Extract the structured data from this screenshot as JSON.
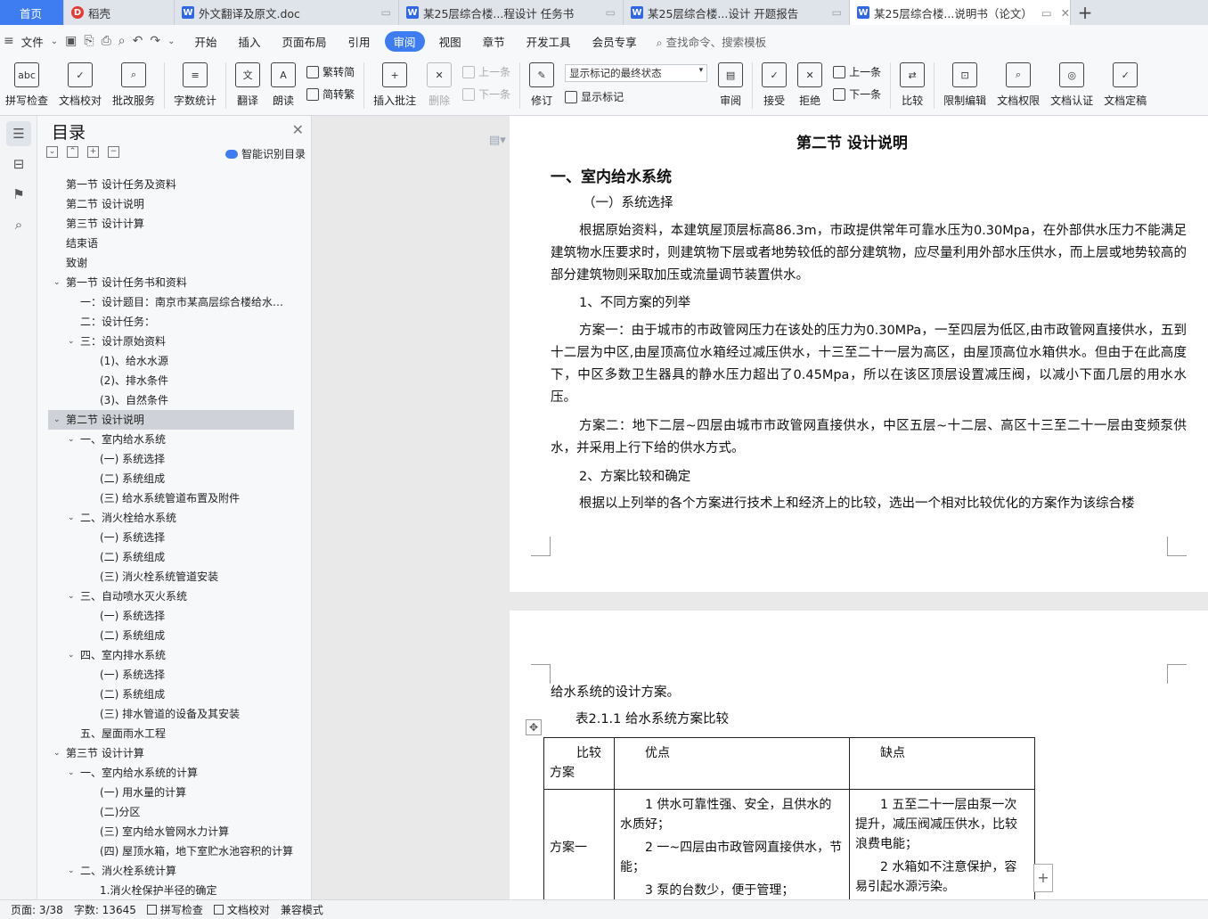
{
  "tabs": [
    {
      "label": "首页"
    },
    {
      "label": "稻壳"
    },
    {
      "label": "外文翻译及原文.doc"
    },
    {
      "label": "某25层综合楼...程设计 任务书"
    },
    {
      "label": "某25层综合楼...设计 开题报告"
    },
    {
      "label": "某25层综合楼...说明书（论文）"
    }
  ],
  "menu": {
    "file": "文件",
    "items": [
      "开始",
      "插入",
      "页面布局",
      "引用",
      "审阅",
      "视图",
      "章节",
      "开发工具",
      "会员专享"
    ],
    "active": "审阅",
    "search": "查找命令、搜索模板"
  },
  "ribbon": {
    "spell": "拼写检查",
    "proof": "文档校对",
    "batch": "批改服务",
    "wordcount": "字数统计",
    "translate": "翻译",
    "read": "朗读",
    "t2s": "繁转简",
    "s2t": "简转繁",
    "insert_comment": "插入批注",
    "delete": "删除",
    "prev": "上一条",
    "next": "下一条",
    "revise": "修订",
    "markup_state": "显示标记的最终状态",
    "show_markup": "显示标记",
    "review": "审阅",
    "accept": "接受",
    "reject": "拒绝",
    "prev2": "上一条",
    "next2": "下一条",
    "compare": "比较",
    "restrict": "限制编辑",
    "perm": "文档权限",
    "cert": "文档认证",
    "final": "文档定稿"
  },
  "toc": {
    "title": "目录",
    "smart": "智能识别目录",
    "items": [
      {
        "t": "第一节  设计任务及资料",
        "lvl": 1,
        "arrow": ""
      },
      {
        "t": "第二节  设计说明",
        "lvl": 1,
        "arrow": ""
      },
      {
        "t": "第三节  设计计算",
        "lvl": 1,
        "arrow": ""
      },
      {
        "t": "结束语",
        "lvl": 1,
        "arrow": ""
      },
      {
        "t": "致谢",
        "lvl": 1,
        "arrow": ""
      },
      {
        "t": "第一节  设计任务书和资料",
        "lvl": 1,
        "arrow": "v"
      },
      {
        "t": "一：设计题目：南京市某高层综合楼给水排水工程设计",
        "lvl": 2,
        "arrow": ""
      },
      {
        "t": "二：设计任务：",
        "lvl": 2,
        "arrow": ""
      },
      {
        "t": "三：设计原始资料",
        "lvl": 2,
        "arrow": "v"
      },
      {
        "t": "(1)、给水水源",
        "lvl": 3,
        "arrow": ""
      },
      {
        "t": "(2)、排水条件",
        "lvl": 3,
        "arrow": ""
      },
      {
        "t": "(3)、自然条件",
        "lvl": 3,
        "arrow": ""
      },
      {
        "t": "第二节  设计说明",
        "lvl": 1,
        "arrow": "v",
        "sel": true
      },
      {
        "t": "一、室内给水系统",
        "lvl": 2,
        "arrow": "v"
      },
      {
        "t": "(一) 系统选择",
        "lvl": 3,
        "arrow": ""
      },
      {
        "t": "(二) 系统组成",
        "lvl": 3,
        "arrow": ""
      },
      {
        "t": "(三)   给水系统管道布置及附件",
        "lvl": 3,
        "arrow": ""
      },
      {
        "t": "二、消火栓给水系统",
        "lvl": 2,
        "arrow": "v"
      },
      {
        "t": "(一) 系统选择",
        "lvl": 3,
        "arrow": ""
      },
      {
        "t": "(二) 系统组成",
        "lvl": 3,
        "arrow": ""
      },
      {
        "t": "(三) 消火栓系统管道安装",
        "lvl": 3,
        "arrow": ""
      },
      {
        "t": "三、自动喷水灭火系统",
        "lvl": 2,
        "arrow": "v"
      },
      {
        "t": "(一) 系统选择",
        "lvl": 3,
        "arrow": ""
      },
      {
        "t": "(二) 系统组成",
        "lvl": 3,
        "arrow": ""
      },
      {
        "t": "四、室内排水系统",
        "lvl": 2,
        "arrow": "v"
      },
      {
        "t": "(一) 系统选择",
        "lvl": 3,
        "arrow": ""
      },
      {
        "t": "(二) 系统组成",
        "lvl": 3,
        "arrow": ""
      },
      {
        "t": "(三) 排水管道的设备及其安装",
        "lvl": 3,
        "arrow": ""
      },
      {
        "t": "五、屋面雨水工程",
        "lvl": 2,
        "arrow": ""
      },
      {
        "t": "第三节 设计计算",
        "lvl": 1,
        "arrow": "v"
      },
      {
        "t": "一、室内给水系统的计算",
        "lvl": 2,
        "arrow": "v"
      },
      {
        "t": "(一) 用水量的计算",
        "lvl": 3,
        "arrow": ""
      },
      {
        "t": "(二)分区",
        "lvl": 3,
        "arrow": ""
      },
      {
        "t": "(三) 室内给水管网水力计算",
        "lvl": 3,
        "arrow": ""
      },
      {
        "t": "(四) 屋顶水箱，地下室贮水池容积的计算",
        "lvl": 3,
        "arrow": ""
      },
      {
        "t": "二、消火栓系统计算",
        "lvl": 2,
        "arrow": "v"
      },
      {
        "t": "1.消火栓保护半径的确定",
        "lvl": 3,
        "arrow": ""
      }
    ]
  },
  "doc": {
    "section_title": "第二节   设计说明",
    "h1": "一、室内给水系统",
    "sub1": "（一）系统选择",
    "para1": "根据原始资料，本建筑屋顶层标高86.3m，市政提供常年可靠水压为0.30Mpa，在外部供水压力不能满足建筑物水压要求时，则建筑物下层或者地势较低的部分建筑物，应尽量利用外部水压供水，而上层或地势较高的部分建筑物则采取加压或流量调节装置供水。",
    "sub2": "1、不同方案的列举",
    "para2": "方案一：由于城市的市政管网压力在该处的压力为0.30MPa，一至四层为低区,由市政管网直接供水，五到十二层为中区,由屋顶高位水箱经过减压供水，十三至二十一层为高区，由屋顶高位水箱供水。但由于在此高度下，中区多数卫生器具的静水压力超出了0.45Mpa，所以在该区顶层设置减压阀，以减小下面几层的用水水压。",
    "para3": "方案二：地下二层~四层由城市市政管网直接供水，中区五层~十二层、高区十三至二十一层由变频泵供水，并采用上行下给的供水方式。",
    "sub3": "2、方案比较和确定",
    "para4": "根据以上列举的各个方案进行技术上和经济上的比较，选出一个相对比较优化的方案作为该综合楼",
    "para5": "给水系统的设计方案。",
    "caption": "表2.1.1  给水系统方案比较",
    "table": {
      "h_compare": "比较",
      "h_plan": "方案",
      "h_adv": "优点",
      "h_dis": "缺点",
      "row1_name": "方案一",
      "row1_adv1": "1 供水可靠性强、安全，且供水的水质好；",
      "row1_adv2": "2 一~四层由市政管网直接供水，节能；",
      "row1_adv3": "3 泵的台数少，便于管理；",
      "row1_dis1": "1 五至二十一层由泵一次提升，减压阀减压供水，比较浪费电能；",
      "row1_dis2": "2 水箱如不注意保护，容易引起水源污染。"
    }
  },
  "status": {
    "page": "页面: 3/38",
    "words": "字数: 13645",
    "spell": "拼写检查",
    "proof": "文档校对",
    "compat": "兼容模式"
  }
}
